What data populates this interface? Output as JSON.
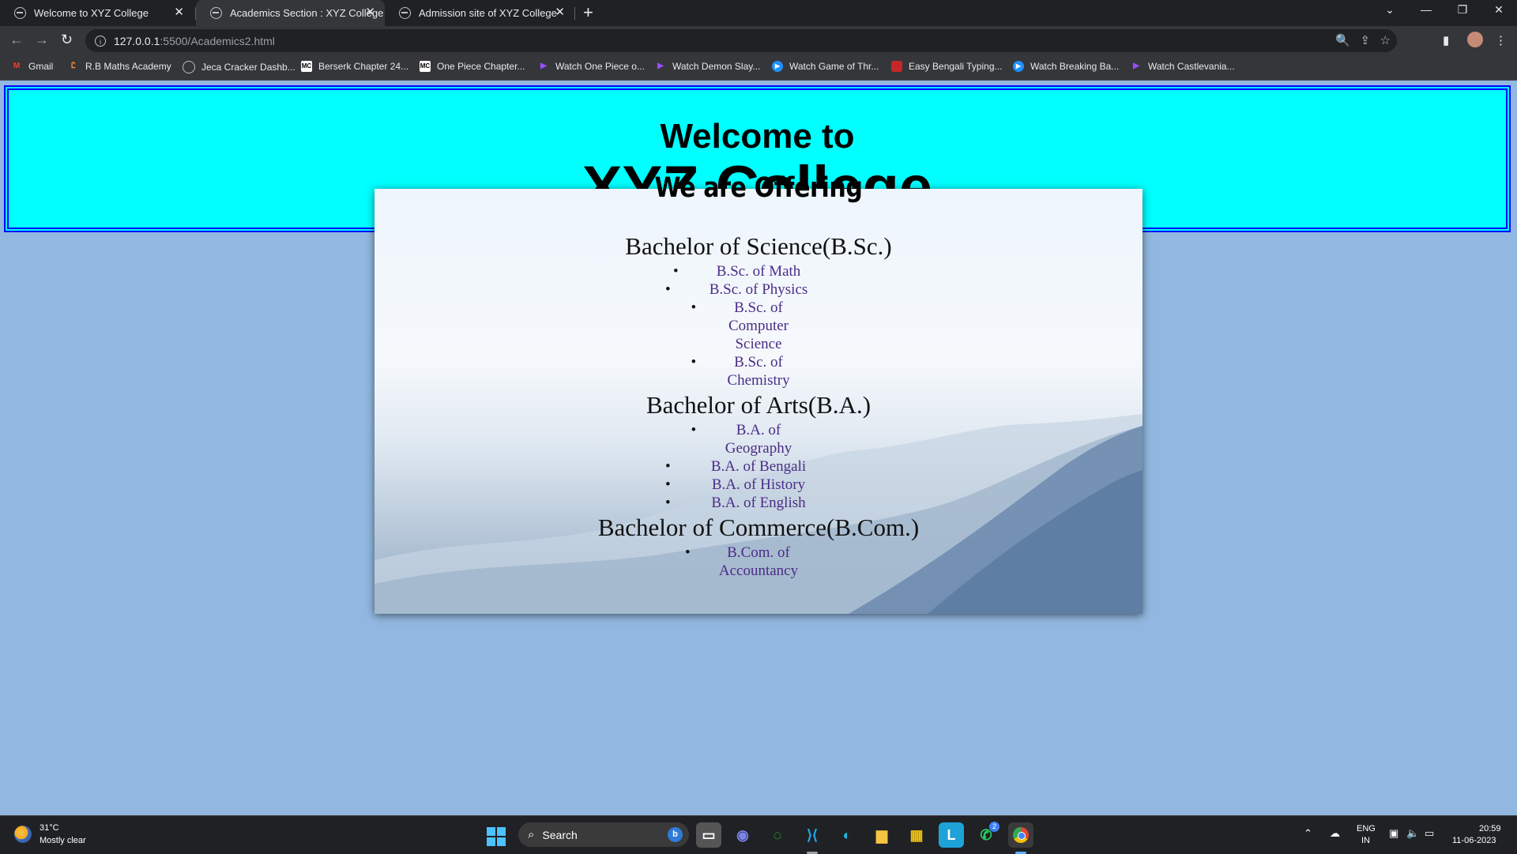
{
  "browser": {
    "tabs": [
      {
        "title": "Welcome to XYZ College",
        "active": false
      },
      {
        "title": "Academics Section : XYZ College",
        "active": true
      },
      {
        "title": "Admission site of XYZ College",
        "active": false
      }
    ],
    "url_host": "127.0.0.1",
    "url_path": ":5500/Academics2.html",
    "bookmarks": [
      {
        "label": "Gmail",
        "icon": "gmail-icon"
      },
      {
        "label": "R.B Maths Academy",
        "icon": "rb-icon"
      },
      {
        "label": "Jeca Cracker Dashb...",
        "icon": "jeca-icon"
      },
      {
        "label": "Berserk Chapter 24...",
        "icon": "mc-icon"
      },
      {
        "label": "One Piece Chapter...",
        "icon": "mc-icon"
      },
      {
        "label": "Watch One Piece o...",
        "icon": "play-icon"
      },
      {
        "label": "Watch Demon Slay...",
        "icon": "play-icon"
      },
      {
        "label": "Watch Game of Thr...",
        "icon": "circle-play-icon"
      },
      {
        "label": "Easy Bengali Typing...",
        "icon": "bengali-icon"
      },
      {
        "label": "Watch Breaking Ba...",
        "icon": "circle-play-icon"
      },
      {
        "label": "Watch Castlevania...",
        "icon": "play-icon"
      }
    ]
  },
  "page": {
    "header_line1": "Welcome to",
    "header_line2": "XYZ College",
    "offer_title": "We are Offering",
    "programs": [
      {
        "name": "Bachelor of Science(B.Sc.)",
        "courses": [
          "B.Sc. of Math",
          "B.Sc. of Physics",
          "B.Sc. of Computer Science",
          "B.Sc. of Chemistry"
        ]
      },
      {
        "name": "Bachelor of Arts(B.A.)",
        "courses": [
          "B.A. of Geography",
          "B.A. of Bengali",
          "B.A. of History",
          "B.A. of English"
        ]
      },
      {
        "name": "Bachelor of Commerce(B.Com.)",
        "courses": [
          "B.Com. of Accountancy"
        ]
      }
    ]
  },
  "taskbar": {
    "weather_temp": "31°C",
    "weather_desc": "Mostly clear",
    "search_placeholder": "Search",
    "lang_line1": "ENG",
    "lang_line2": "IN",
    "time": "20:59",
    "date": "11-06-2023",
    "whatsapp_badge": "2"
  },
  "colors": {
    "header_bg": "#00ffff",
    "header_border": "#0000ff",
    "page_bg": "#92b8e1",
    "link_color": "#4b2c86"
  }
}
